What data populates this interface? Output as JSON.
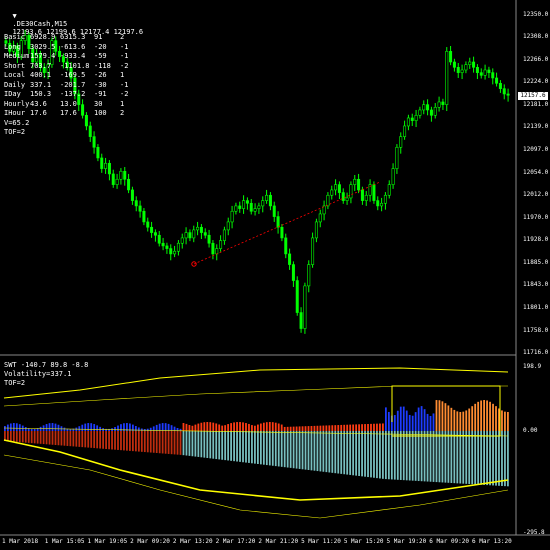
{
  "header": {
    "symbol": ".DE30Cash,M15",
    "ohlc": "12193.6 12199.6 12177.4 12197.6"
  },
  "stats": [
    {
      "label": "Basic",
      "v1": "6928.9",
      "v2": "6315.3",
      "v3": "91",
      "v4": "2"
    },
    {
      "label": "Long",
      "v1": "3029.5",
      "v2": "-613.6",
      "v3": "-20",
      "v4": "-1"
    },
    {
      "label": "Medium",
      "v1": "1579.4",
      "v2": "-933.4",
      "v3": "-59",
      "v4": "-1"
    },
    {
      "label": "Short",
      "v1": "703.7",
      "v2": "-1101.8",
      "v3": "-118",
      "v4": "-2"
    },
    {
      "label": "Local",
      "v1": "400.1",
      "v2": "-169.5",
      "v3": "-26",
      "v4": "1"
    },
    {
      "label": "Daily",
      "v1": "337.1",
      "v2": "-201.7",
      "v3": "-30",
      "v4": "-1"
    },
    {
      "label": "IDay",
      "v1": "150.3",
      "v2": "-137.2",
      "v3": "-91",
      "v4": "-2"
    },
    {
      "label": "Hourly",
      "v1": "43.6",
      "v2": "13.0",
      "v3": "30",
      "v4": "1"
    },
    {
      "label": "IHour",
      "v1": "17.6",
      "v2": "17.6",
      "v3": "100",
      "v4": "2"
    }
  ],
  "stats_extra": [
    "V=65.2",
    "TOF=2"
  ],
  "indicator": {
    "header": "SWT -140.7 89.8 -8.8",
    "volatility": "Volatility=337.1",
    "tof": "TOF=2",
    "scale_max": "198.9",
    "scale_zero": "0.00",
    "scale_min": "-295.8"
  },
  "colors": {
    "background": "#000000",
    "candle_up": "#00ff00",
    "candle_down": "#00ff00",
    "trend_line": "#ff0000",
    "yellow": "#ffff00",
    "hist_blue": "#1e3cff",
    "hist_cyan": "#a0ffff",
    "hist_red": "#ff3c14",
    "hist_orange": "#ff8c32",
    "current_price_bg": "#ffffff"
  },
  "current_price": "12157.6",
  "chart_data": {
    "type": "line",
    "title": ".DE30Cash,M15",
    "price_axis": [
      "12350.0",
      "12308.0",
      "12266.0",
      "12224.0",
      "12181.0",
      "12139.0",
      "12097.0",
      "12054.0",
      "12012.0",
      "11970.0",
      "11928.0",
      "11885.0",
      "11843.0",
      "11801.0",
      "11758.0",
      "11716.0"
    ],
    "time_axis": [
      "1 Mar 2018",
      "1 Mar 15:05",
      "1 Mar 19:05",
      "2 Mar 09:20",
      "2 Mar 13:20",
      "2 Mar 17:20",
      "2 Mar 21:20",
      "5 Mar 11:20",
      "5 Mar 15:20",
      "5 Mar 19:20",
      "6 Mar 09:20",
      "6 Mar 13:20"
    ],
    "ylim": [
      11716,
      12350
    ],
    "series": [
      {
        "name": ".DE30Cash,M15",
        "values": [
          12295,
          12280,
          12290,
          12270,
          12300,
          12310,
          12285,
          12260,
          12275,
          12250,
          12240,
          12255,
          12300,
          12280,
          12270,
          12260,
          12250,
          12230,
          12200,
          12180,
          12160,
          12140,
          12120,
          12100,
          12080,
          12060,
          12070,
          12050,
          12030,
          12040,
          12055,
          12040,
          12020,
          12000,
          11990,
          11980,
          11960,
          11950,
          11940,
          11935,
          11920,
          11915,
          11910,
          11900,
          11905,
          11920,
          11930,
          11940,
          11930,
          11945,
          11950,
          11940,
          11935,
          11920,
          11900,
          11910,
          11925,
          11945,
          11960,
          11980,
          11990,
          11985,
          12000,
          11995,
          11980,
          11985,
          11990,
          12000,
          12010,
          11990,
          11970,
          11950,
          11930,
          11900,
          11880,
          11850,
          11790,
          11760,
          11840,
          11880,
          11930,
          11960,
          11975,
          11990,
          12010,
          12020,
          12030,
          12015,
          12000,
          12005,
          12030,
          12040,
          12020,
          12000,
          12010,
          12030,
          12000,
          11990,
          11995,
          12010,
          12030,
          12060,
          12100,
          12120,
          12140,
          12155,
          12150,
          12160,
          12170,
          12180,
          12170,
          12160,
          12175,
          12185,
          12180,
          12280,
          12260,
          12250,
          12240,
          12245,
          12255,
          12260,
          12250,
          12240,
          12235,
          12245,
          12240,
          12230,
          12220,
          12210,
          12200,
          12197.6
        ]
      }
    ]
  }
}
